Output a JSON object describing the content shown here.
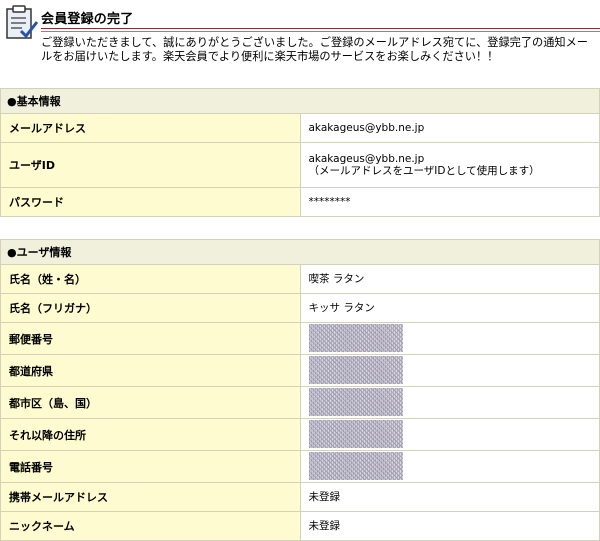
{
  "header": {
    "title": "会員登録の完了",
    "message": "ご登録いただきまして、誠にありがとうございました。ご登録のメールアドレス宛てに、登録完了の通知メールをお届けいたします。楽天会員でより便利に楽天市場のサービスをお楽しみください！！"
  },
  "basic": {
    "section_title": "●基本情報",
    "email_label": "メールアドレス",
    "email_value": "akakageus@ybb.ne.jp",
    "userid_label": "ユーザID",
    "userid_value": "akakageus@ybb.ne.jp",
    "userid_note": "（メールアドレスをユーザIDとして使用します）",
    "password_label": "パスワード",
    "password_value": "********"
  },
  "user": {
    "section_title": "●ユーザ情報",
    "name_label": "氏名（姓・名）",
    "name_value": "喫茶 ラタン",
    "kana_label": "氏名（フリガナ）",
    "kana_value": "キッサ ラタン",
    "postal_label": "郵便番号",
    "pref_label": "都道府県",
    "city_label": "都市区（島、国）",
    "address_label": "それ以降の住所",
    "phone_label": "電話番号",
    "mobile_label": "携帯メールアドレス",
    "mobile_value": "未登録",
    "nickname_label": "ニックネーム",
    "nickname_value": "未登録"
  },
  "icons": {
    "logo": "clipboard-check-icon"
  },
  "colors": {
    "rule": "#8b2d2d",
    "label_bg": "#fffbd0",
    "section_bg": "#f0f0dc",
    "border": "#d2d2b8"
  }
}
